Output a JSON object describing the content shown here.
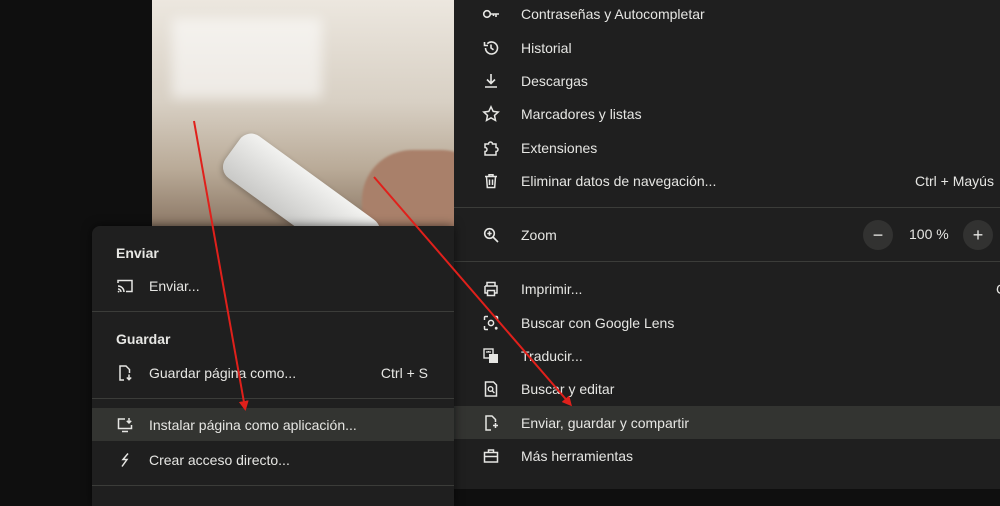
{
  "main_menu": {
    "items": [
      {
        "label": "Contraseñas y Autocompletar",
        "icon": "key-icon"
      },
      {
        "label": "Historial",
        "icon": "history-icon"
      },
      {
        "label": "Descargas",
        "icon": "download-icon"
      },
      {
        "label": "Marcadores y listas",
        "icon": "star-icon"
      },
      {
        "label": "Extensiones",
        "icon": "puzzle-icon"
      },
      {
        "label": "Eliminar datos de navegación...",
        "icon": "trash-icon",
        "shortcut": "Ctrl + Mayús"
      },
      {
        "label": "Zoom",
        "icon": "zoom-icon"
      },
      {
        "label": "Imprimir...",
        "icon": "printer-icon",
        "shortcut": "C"
      },
      {
        "label": "Buscar con Google Lens",
        "icon": "lens-icon"
      },
      {
        "label": "Traducir...",
        "icon": "translate-icon"
      },
      {
        "label": "Buscar y editar",
        "icon": "find-icon"
      },
      {
        "label": "Enviar, guardar y compartir",
        "icon": "share-icon"
      },
      {
        "label": "Más herramientas",
        "icon": "toolbox-icon"
      }
    ],
    "zoom": {
      "minus": "−",
      "value": "100 %",
      "plus": "+"
    }
  },
  "sub_menu": {
    "send_heading": "Enviar",
    "send_item": "Enviar...",
    "save_heading": "Guardar",
    "save_item": "Guardar página como...",
    "save_shortcut": "Ctrl + S",
    "install_item": "Instalar página como aplicación...",
    "shortcut_item": "Crear acceso directo..."
  },
  "colors": {
    "menu_bg": "#1f1f1f",
    "highlight": "#333431",
    "arrow": "#e0201b"
  }
}
